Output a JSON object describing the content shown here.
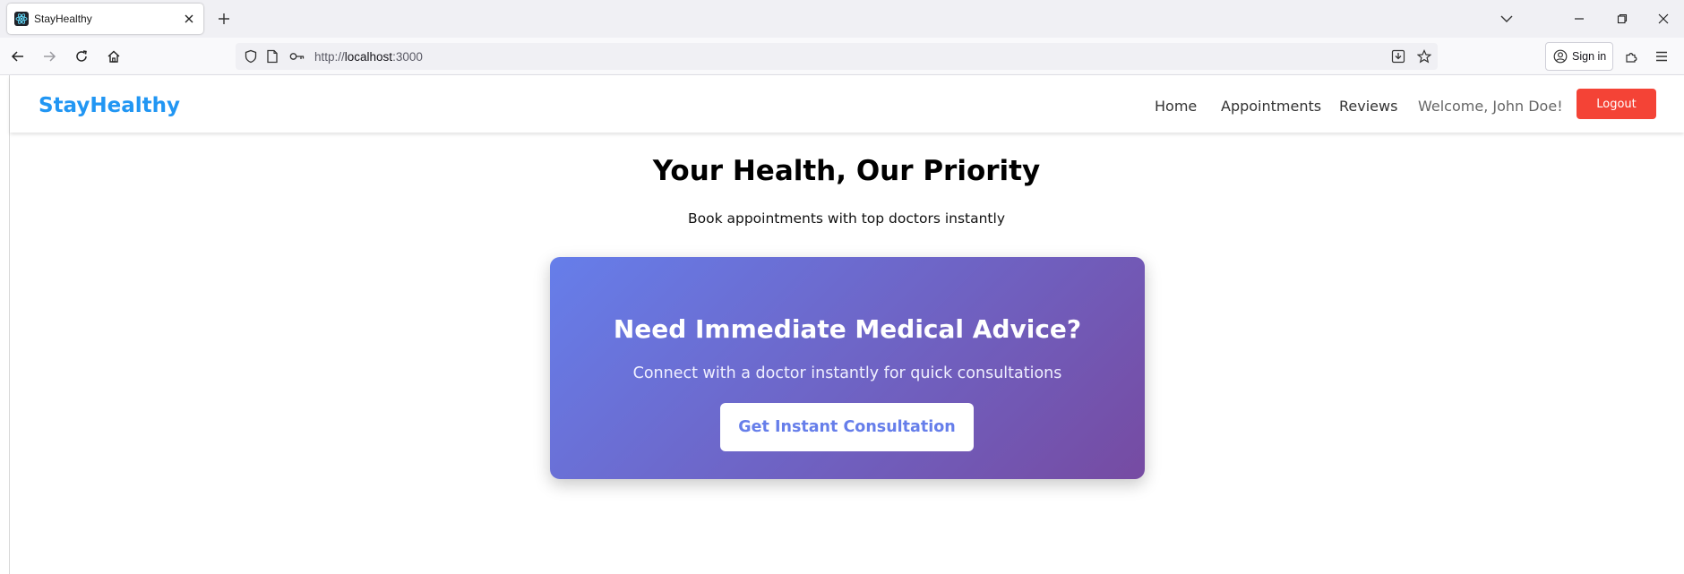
{
  "browser": {
    "tab_title": "StayHealthy",
    "url_scheme": "http://",
    "url_host": "localhost",
    "url_rest": ":3000",
    "signin_label": "Sign in"
  },
  "site": {
    "brand": "StayHealthy",
    "nav": [
      "Home",
      "Appointments",
      "Reviews"
    ],
    "welcome": "Welcome, John Doe!",
    "logout_label": "Logout"
  },
  "hero": {
    "title": "Your Health, Our Priority",
    "subtitle": "Book appointments with top doctors instantly"
  },
  "consultation_card": {
    "title": "Need Immediate Medical Advice?",
    "subtitle": "Connect with a doctor instantly for quick consultations",
    "button_label": "Get Instant Consultation"
  },
  "colors": {
    "brand_blue": "#2196f3",
    "logout_red": "#f44336",
    "gradient_start": "#667eea",
    "gradient_end": "#764ba2"
  }
}
